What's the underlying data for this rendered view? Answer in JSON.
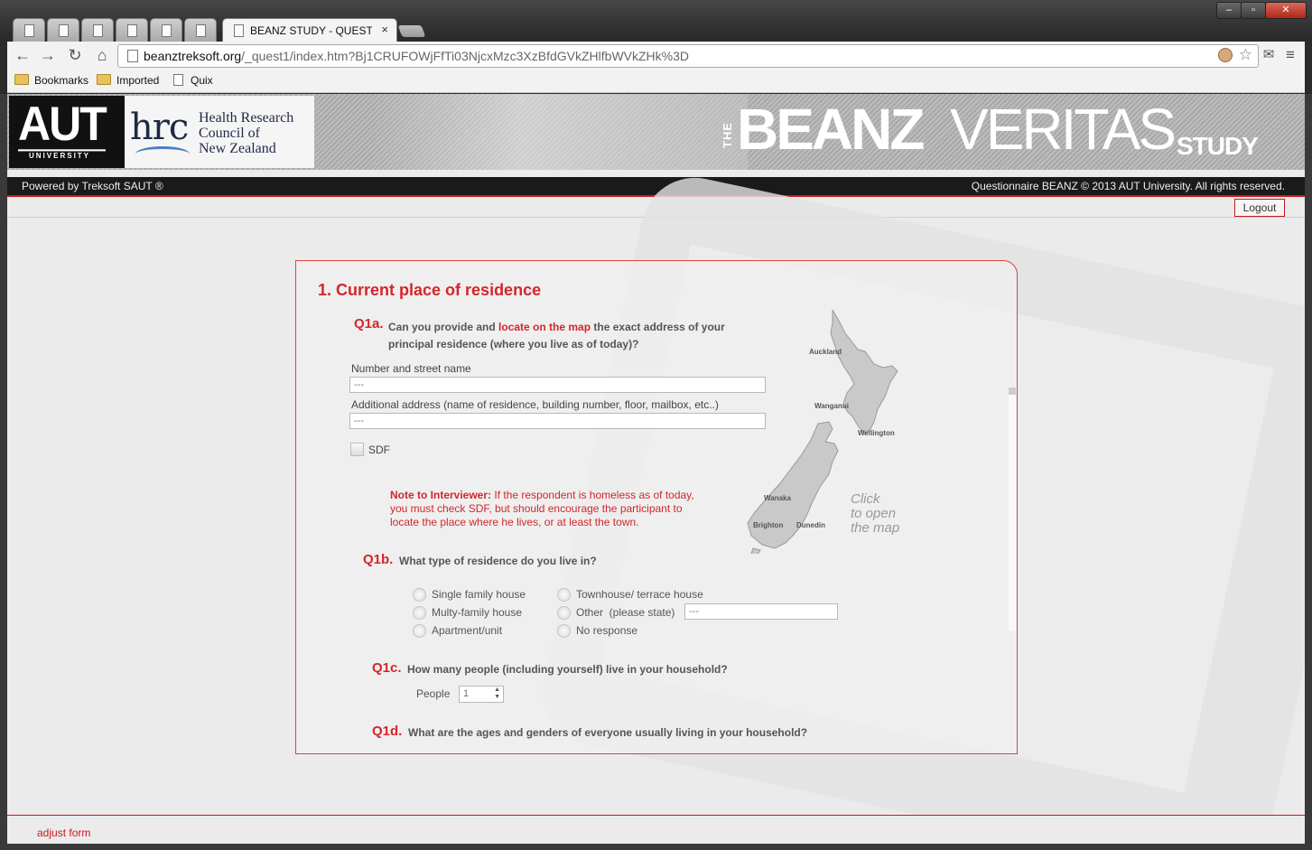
{
  "browser": {
    "active_tab_title": "BEANZ STUDY - QUESTIO",
    "tab_close": "×",
    "url_host": "beanztreksoft.org",
    "url_path": "/_quest1/index.htm?Bj1CRUFOWjFfTi03NjcxMzc3XzBfdGVkZHlfbWVkZHk%3D",
    "bookmarks": [
      "Bookmarks",
      "Imported",
      "Quix"
    ],
    "window_buttons": [
      "–",
      "▫",
      "✕"
    ]
  },
  "banner": {
    "aut_logo": "AUT",
    "aut_sub": "UNIVERSITY",
    "hrc_logo": "hrc",
    "hrc_line1": "Health Research",
    "hrc_line2": "Council of",
    "hrc_line3": "New Zealand",
    "study_the": "THE",
    "study_beanz": "BEANZ",
    "study_veritas": "VERITAS",
    "study_study": "STUDY"
  },
  "statusbar": {
    "left": "Powered by Treksoft SAUT ®",
    "right": "Questionnaire BEANZ © 2013 AUT University. All rights reserved."
  },
  "logout_label": "Logout",
  "section": {
    "title": "1. Current place of residence",
    "q1a_label": "Q1a.",
    "q1a_text_1": "Can you provide and",
    "q1a_link": "locate on the map",
    "q1a_text_2": "the exact address of your",
    "q1a_text_3": "principal residence (where you live as of today)?",
    "street_label": "Number and street name",
    "street_value": "---",
    "additional_label": "Additional address (name of residence, building number, floor, mailbox, etc..)",
    "additional_value": "---",
    "sdf_label": "SDF",
    "note_bold": "Note to Interviewer:",
    "note_text_1": "If the respondent is homeless as of today,",
    "note_text_2": "you must check SDF, but should encourage the participant to",
    "note_text_3": "locate the place where he lives, or at least the town.",
    "map_click": [
      "Click",
      "to open",
      "the map"
    ],
    "map_cities": [
      "Auckland",
      "Wanganui",
      "Wellington",
      "Wanaka",
      "Brighton",
      "Dunedin"
    ],
    "q1b_label": "Q1b.",
    "q1b_text": "What type of residence do you live in?",
    "q1b_options_left": [
      "Single family house",
      "Multy-family house",
      "Apartment/unit"
    ],
    "q1b_options_right": [
      "Townhouse/ terrace house",
      "Other  (please state)",
      "No response"
    ],
    "q1b_other_value": "---",
    "q1c_label": "Q1c.",
    "q1c_text": "How many people (including yourself) live in your household?",
    "people_label": "People",
    "people_value": "1",
    "q1d_label": "Q1d.",
    "q1d_text": "What are the ages and genders of everyone usually living in your household?"
  },
  "footer": {
    "adjust_form": "adjust form"
  }
}
